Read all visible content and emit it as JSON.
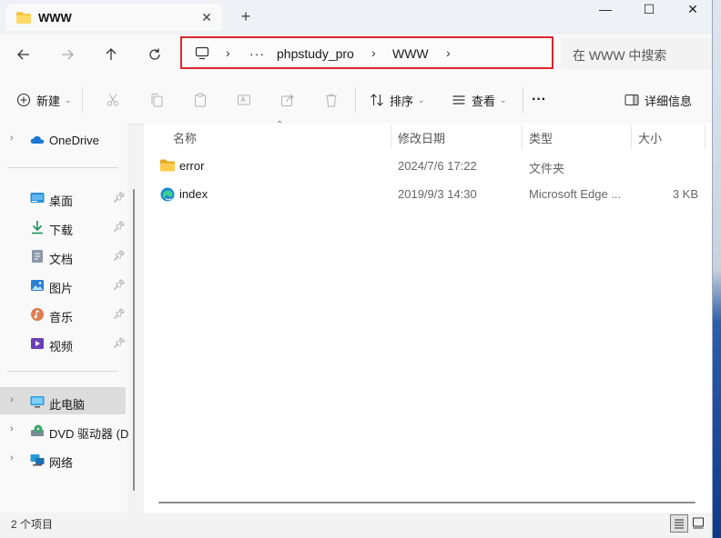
{
  "window": {
    "tab_title": "WWW",
    "tab_close": "✕",
    "new_tab": "+",
    "minimize": "—",
    "maximize": "☐",
    "close": "✕"
  },
  "navigation": {
    "overflow": "···",
    "breadcrumb": [
      "phpstudy_pro",
      "WWW"
    ],
    "separator": "›",
    "search_placeholder": "在 WWW 中搜索"
  },
  "toolbar": {
    "new_label": "新建",
    "sort_label": "排序",
    "view_label": "查看",
    "more_label": "···",
    "details_label": "详细信息"
  },
  "sidebar": {
    "onedrive": "OneDrive",
    "quick_access": [
      {
        "label": "桌面",
        "icon": "desktop-icon"
      },
      {
        "label": "下载",
        "icon": "download-icon"
      },
      {
        "label": "文档",
        "icon": "document-icon"
      },
      {
        "label": "图片",
        "icon": "picture-icon"
      },
      {
        "label": "音乐",
        "icon": "music-icon"
      },
      {
        "label": "视频",
        "icon": "video-icon"
      }
    ],
    "this_pc": "此电脑",
    "dvd": "DVD 驱动器 (D",
    "network": "网络"
  },
  "columns": {
    "name": "名称",
    "modified": "修改日期",
    "type": "类型",
    "size": "大小"
  },
  "files": [
    {
      "name": "error",
      "modified": "2024/7/6 17:22",
      "type": "文件夹",
      "size": "",
      "icon": "folder-icon"
    },
    {
      "name": "index",
      "modified": "2019/9/3 14:30",
      "type": "Microsoft Edge ...",
      "size": "3 KB",
      "icon": "edge-icon"
    }
  ],
  "status": {
    "item_count": "2 个项目"
  },
  "colors": {
    "highlight_border": "#d9272d",
    "folder": "#f4c542",
    "selected_bg": "#dcdcdc"
  }
}
